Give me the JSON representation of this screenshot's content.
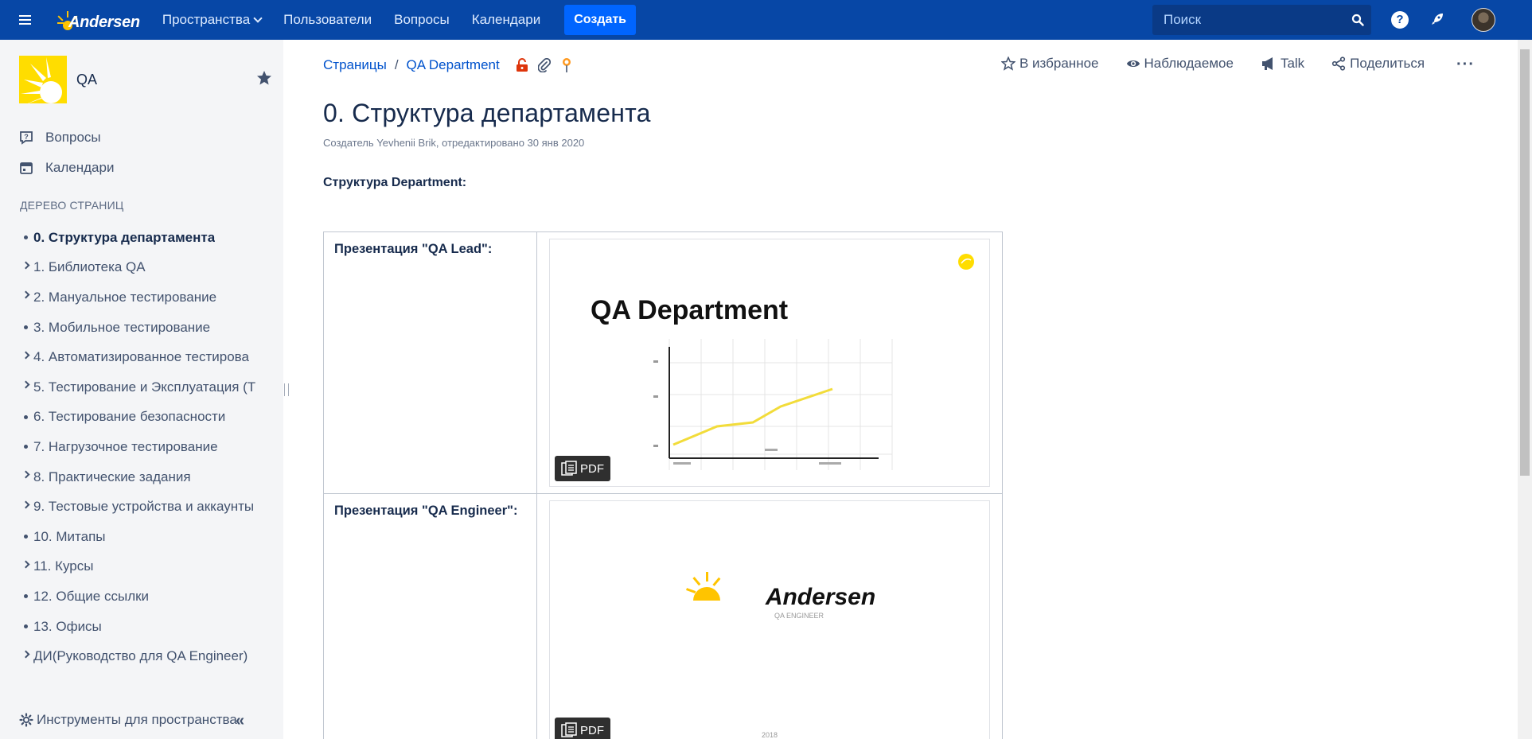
{
  "nav": {
    "logo": "Andersen",
    "spaces": "Пространства",
    "users": "Пользователи",
    "questions": "Вопросы",
    "calendars": "Календари",
    "create": "Создать",
    "search_placeholder": "Поиск",
    "help": "?"
  },
  "sidebar": {
    "space_name": "QA",
    "links": [
      {
        "label": "Вопросы",
        "icon": "questions-icon"
      },
      {
        "label": "Календари",
        "icon": "calendar-icon"
      }
    ],
    "tree_title": "ДЕРЕВО СТРАНИЦ",
    "tree": [
      {
        "label": "0. Структура департамента",
        "children": false,
        "active": true
      },
      {
        "label": "1. Библиотека QA",
        "children": true
      },
      {
        "label": "2. Мануальное тестирование",
        "children": true
      },
      {
        "label": "3. Мобильное тестирование",
        "children": false
      },
      {
        "label": "4. Автоматизированное тестирова",
        "children": true
      },
      {
        "label": "5. Тестирование и Эксплуатация (Т",
        "children": true
      },
      {
        "label": "6. Тестирование безопасности",
        "children": false
      },
      {
        "label": "7. Нагрузочное тестирование",
        "children": false
      },
      {
        "label": "8. Практические задания",
        "children": true
      },
      {
        "label": "9. Тестовые устройства и аккаунты",
        "children": true
      },
      {
        "label": "10. Митапы",
        "children": false
      },
      {
        "label": "11. Курсы",
        "children": true
      },
      {
        "label": "12. Общие ссылки",
        "children": false
      },
      {
        "label": "13. Офисы",
        "children": false
      },
      {
        "label": "ДИ(Руководство для QA Engineer)",
        "children": true
      }
    ],
    "tools": "Инструменты для пространства",
    "collapse": "«"
  },
  "page": {
    "breadcrumbs": [
      "Страницы",
      "QA Department"
    ],
    "actions": {
      "favorite": "В избранное",
      "watch": "Наблюдаемое",
      "talk": "Talk",
      "share": "Поделиться",
      "more": "···"
    },
    "title": "0. Структура департамента",
    "byline": "Создатель Yevhenii Brik, отредактировано 30 янв 2020",
    "section_heading": "Структура Department:",
    "rows": [
      {
        "label": "Презентация \"QA Lead\":",
        "slide_title": "QA Department",
        "badge": "PDF"
      },
      {
        "label": "Презентация \"QA Engineer\":",
        "slide_logo": "Andersen",
        "slide_subtitle": "QA ENGINEER",
        "slide_year": "2018",
        "badge": "PDF"
      }
    ]
  },
  "colors": {
    "nav_bg": "#0747a6",
    "create_btn": "#0065ff",
    "sidebar_bg": "#f4f5f7",
    "link": "#0052cc",
    "brand_yellow": "#ffdd00"
  }
}
